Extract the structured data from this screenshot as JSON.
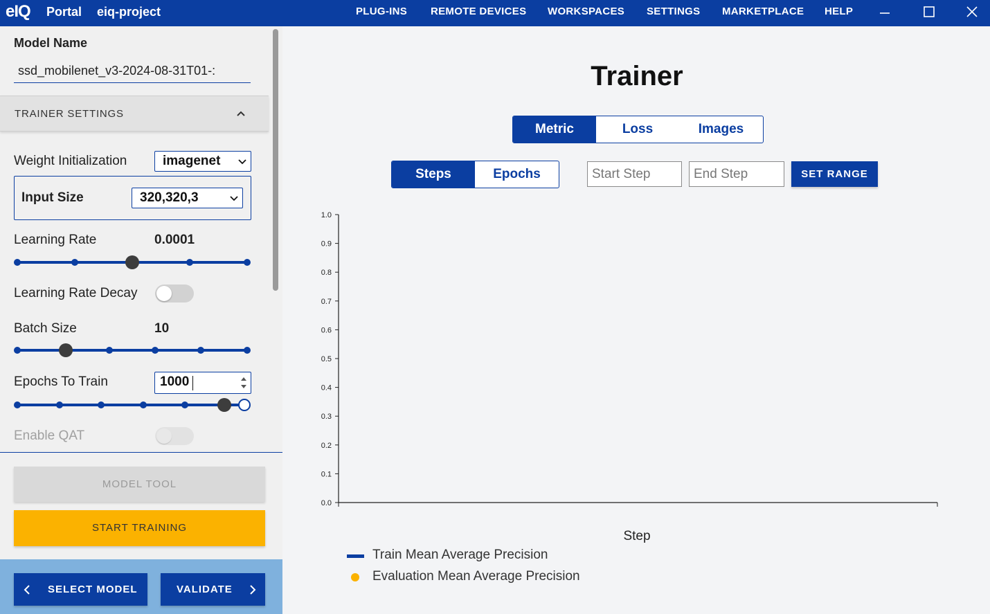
{
  "titlebar": {
    "logo": "eIQ",
    "app_name": "Portal",
    "project_name": "eiq-project",
    "nav": [
      "PLUG-INS",
      "REMOTE DEVICES",
      "WORKSPACES",
      "SETTINGS",
      "MARKETPLACE",
      "HELP"
    ]
  },
  "sidebar": {
    "model_name_label": "Model Name",
    "model_name_value": "ssd_mobilenet_v3-2024-08-31T01-:",
    "section_title": "TRAINER SETTINGS",
    "weight_init": {
      "label": "Weight Initialization",
      "value": "imagenet"
    },
    "input_size": {
      "label": "Input Size",
      "value": "320,320,3"
    },
    "learning_rate": {
      "label": "Learning Rate",
      "value": "0.0001",
      "position": 0.5
    },
    "lr_decay": {
      "label": "Learning Rate Decay",
      "enabled": false
    },
    "batch_size": {
      "label": "Batch Size",
      "value": "10",
      "position": 0.2
    },
    "epochs": {
      "label": "Epochs To Train",
      "value": "1000"
    },
    "qat": {
      "label": "Enable QAT",
      "enabled": false
    },
    "model_tool_label": "MODEL TOOL",
    "start_training_label": "START TRAINING",
    "select_model_label": "SELECT MODEL",
    "validate_label": "VALIDATE"
  },
  "main": {
    "title": "Trainer",
    "view_tabs": [
      "Metric",
      "Loss",
      "Images"
    ],
    "active_view_tab": "Metric",
    "unit_tabs": [
      "Steps",
      "Epochs"
    ],
    "active_unit_tab": "Steps",
    "start_step_placeholder": "Start Step",
    "end_step_placeholder": "End Step",
    "set_range_label": "SET RANGE"
  },
  "chart_data": {
    "type": "line",
    "xlabel": "Step",
    "ylabel": "",
    "ylim": [
      0,
      1
    ],
    "y_ticks": [
      "0.0",
      "0.1",
      "0.2",
      "0.3",
      "0.4",
      "0.5",
      "0.6",
      "0.7",
      "0.8",
      "0.9",
      "1.0"
    ],
    "series": [
      {
        "name": "Train Mean Average Precision",
        "values": []
      },
      {
        "name": "Evaluation Mean Average Precision",
        "values": []
      }
    ]
  },
  "colors": {
    "primary": "#0b3ea1",
    "accent": "#fbb200",
    "bottom_bar": "#7fb1dd"
  }
}
